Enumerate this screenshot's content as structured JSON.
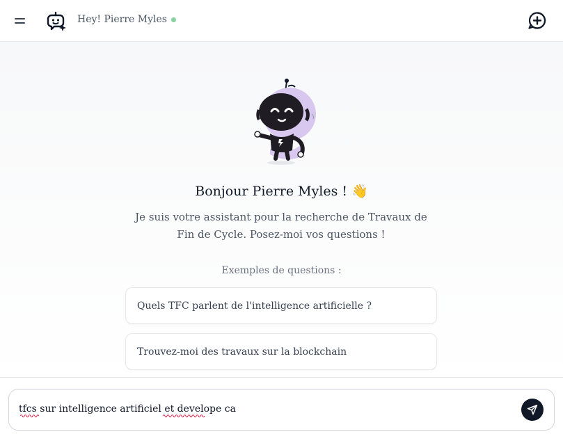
{
  "header": {
    "greeting": "Hey! Pierre Myles",
    "status_color": "#86d3a0",
    "menu_icon": "hamburger-menu-icon",
    "logo_icon": "robot-sparkle-icon",
    "new_chat_icon": "new-chat-plus-icon"
  },
  "welcome": {
    "title": "Bonjour Pierre Myles ! 👋",
    "subtitle": "Je suis votre assistant pour la recherche de Travaux de Fin de Cycle. Posez-moi vos questions !",
    "mascot_icon": "robot-mascot-illustration"
  },
  "examples": {
    "label": "Exemples de questions :",
    "items": [
      "Quels TFC parlent de l'intelligence artificielle ?",
      "Trouvez-moi des travaux sur la blockchain"
    ]
  },
  "composer": {
    "value": "tfcs sur intelligence artificiel et develope ca",
    "send_icon": "send-paper-plane-icon"
  },
  "colors": {
    "accent": "#111827",
    "mascot_purple": "#d8c7ee",
    "text_muted": "#4b5563"
  }
}
